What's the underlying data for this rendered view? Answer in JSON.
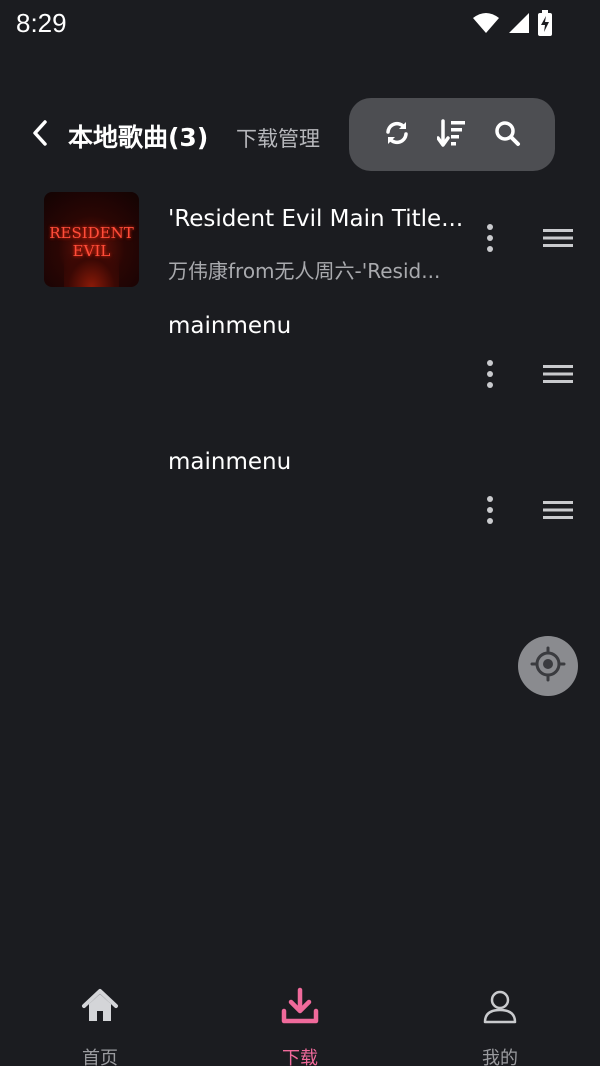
{
  "status": {
    "time": "8:29"
  },
  "header": {
    "title": "本地歌曲(3)",
    "sub_link": "下载管理",
    "actions": [
      {
        "icon": "refresh-icon"
      },
      {
        "icon": "sort-icon"
      },
      {
        "icon": "search-icon"
      }
    ]
  },
  "songs": [
    {
      "title": "'Resident Evil Main Title...",
      "artist": "万伟康from无人周六-'Resid...",
      "cover_text_1": "RESIDENT",
      "cover_text_2": "EVIL"
    },
    {
      "title": "mainmenu",
      "artist": ""
    },
    {
      "title": "mainmenu",
      "artist": ""
    }
  ],
  "fab": {
    "icon": "locate-icon"
  },
  "bottom_nav": [
    {
      "label": "首页",
      "icon": "home-icon",
      "active": false
    },
    {
      "label": "下载",
      "icon": "download-icon",
      "active": true
    },
    {
      "label": "我的",
      "icon": "user-icon",
      "active": false
    }
  ],
  "colors": {
    "background": "#1b1c20",
    "accent": "#f06a9b",
    "pill": "#4d4e52",
    "muted_text": "#a9aaae"
  }
}
